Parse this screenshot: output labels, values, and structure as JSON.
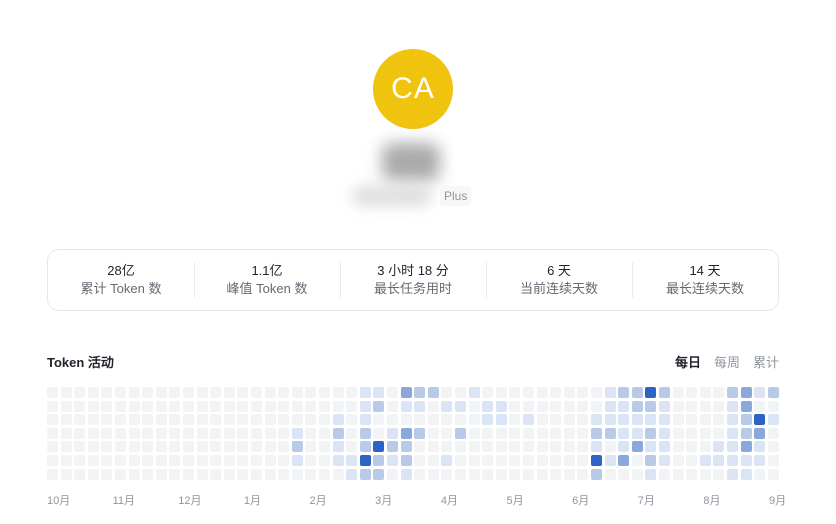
{
  "profile": {
    "avatar_initials": "CA",
    "avatar_color": "#f0c30f",
    "plan_badge": "Plus"
  },
  "stats": [
    {
      "value": "28亿",
      "label": "累计 Token 数"
    },
    {
      "value": "1.1亿",
      "label": "峰值 Token 数"
    },
    {
      "value": "3 小时 18 分",
      "label": "最长任务用时"
    },
    {
      "value": "6 天",
      "label": "当前连续天数"
    },
    {
      "value": "14 天",
      "label": "最长连续天数"
    }
  ],
  "activity": {
    "title": "Token 活动",
    "tabs": [
      {
        "label": "每日",
        "active": true
      },
      {
        "label": "每周",
        "active": false
      },
      {
        "label": "累计",
        "active": false
      }
    ],
    "months": [
      "10月",
      "11月",
      "12月",
      "1月",
      "2月",
      "3月",
      "4月",
      "5月",
      "6月",
      "7月",
      "8月",
      "9月"
    ],
    "level_colors": [
      "#f2f3f5",
      "#dbe4f4",
      "#b8cae8",
      "#8aa8db",
      "#2f62c6"
    ],
    "levels_by_week": [
      [
        0,
        0,
        0,
        0,
        0,
        0,
        0
      ],
      [
        0,
        0,
        0,
        0,
        0,
        0,
        0
      ],
      [
        0,
        0,
        0,
        0,
        0,
        0,
        0
      ],
      [
        0,
        0,
        0,
        0,
        0,
        0,
        0
      ],
      [
        0,
        0,
        0,
        0,
        0,
        0,
        0
      ],
      [
        0,
        0,
        0,
        0,
        0,
        0,
        0
      ],
      [
        0,
        0,
        0,
        0,
        0,
        0,
        0
      ],
      [
        0,
        0,
        0,
        0,
        0,
        0,
        0
      ],
      [
        0,
        0,
        0,
        0,
        0,
        0,
        0
      ],
      [
        0,
        0,
        0,
        0,
        0,
        0,
        0
      ],
      [
        0,
        0,
        0,
        0,
        0,
        0,
        0
      ],
      [
        0,
        0,
        0,
        0,
        0,
        0,
        0
      ],
      [
        0,
        0,
        0,
        0,
        0,
        0,
        0
      ],
      [
        0,
        0,
        0,
        0,
        0,
        0,
        0
      ],
      [
        0,
        0,
        0,
        0,
        0,
        0,
        0
      ],
      [
        0,
        0,
        0,
        0,
        0,
        0,
        0
      ],
      [
        0,
        0,
        0,
        0,
        0,
        0,
        0
      ],
      [
        0,
        0,
        0,
        0,
        0,
        0,
        0
      ],
      [
        0,
        0,
        0,
        1,
        2,
        1,
        0
      ],
      [
        0,
        0,
        0,
        0,
        0,
        0,
        0
      ],
      [
        0,
        0,
        0,
        0,
        0,
        0,
        0
      ],
      [
        0,
        0,
        1,
        2,
        1,
        1,
        0
      ],
      [
        0,
        0,
        0,
        0,
        0,
        1,
        1
      ],
      [
        1,
        1,
        1,
        2,
        2,
        4,
        2
      ],
      [
        1,
        2,
        0,
        0,
        4,
        2,
        2
      ],
      [
        0,
        0,
        0,
        1,
        2,
        1,
        0
      ],
      [
        3,
        1,
        0,
        3,
        2,
        2,
        1
      ],
      [
        2,
        1,
        0,
        2,
        0,
        0,
        0
      ],
      [
        2,
        0,
        0,
        0,
        0,
        0,
        0
      ],
      [
        0,
        1,
        0,
        0,
        0,
        1,
        0
      ],
      [
        0,
        1,
        0,
        2,
        0,
        0,
        0
      ],
      [
        1,
        0,
        0,
        0,
        0,
        0,
        0
      ],
      [
        0,
        1,
        1,
        0,
        0,
        0,
        0
      ],
      [
        0,
        1,
        1,
        0,
        0,
        0,
        0
      ],
      [
        0,
        0,
        0,
        0,
        0,
        0,
        0
      ],
      [
        0,
        0,
        1,
        0,
        0,
        0,
        0
      ],
      [
        0,
        0,
        0,
        0,
        0,
        0,
        0
      ],
      [
        0,
        0,
        0,
        0,
        0,
        0,
        0
      ],
      [
        0,
        0,
        0,
        0,
        0,
        0,
        0
      ],
      [
        0,
        0,
        0,
        0,
        0,
        0,
        0
      ],
      [
        0,
        0,
        1,
        2,
        1,
        4,
        2
      ],
      [
        1,
        1,
        1,
        2,
        0,
        1,
        0
      ],
      [
        2,
        1,
        1,
        1,
        1,
        3,
        0
      ],
      [
        2,
        2,
        1,
        1,
        3,
        0,
        0
      ],
      [
        4,
        2,
        1,
        2,
        1,
        2,
        1
      ],
      [
        2,
        1,
        1,
        1,
        1,
        1,
        0
      ],
      [
        0,
        0,
        0,
        0,
        0,
        0,
        0
      ],
      [
        0,
        0,
        0,
        0,
        0,
        0,
        0
      ],
      [
        0,
        0,
        0,
        0,
        0,
        1,
        0
      ],
      [
        0,
        0,
        0,
        0,
        1,
        1,
        0
      ],
      [
        2,
        1,
        1,
        1,
        1,
        1,
        1
      ],
      [
        3,
        3,
        2,
        2,
        3,
        1,
        1
      ],
      [
        1,
        0,
        4,
        3,
        1,
        1,
        0
      ],
      [
        2,
        0,
        1,
        0,
        0,
        0,
        0
      ]
    ]
  }
}
